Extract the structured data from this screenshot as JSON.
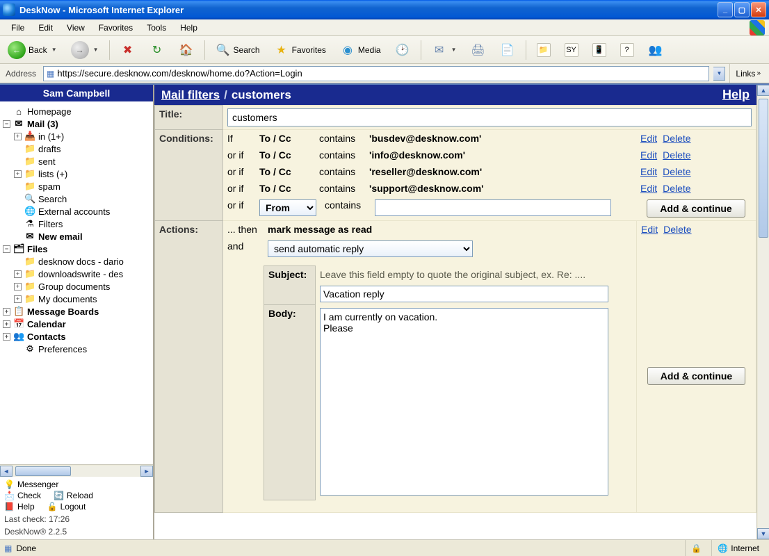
{
  "window": {
    "title": "DeskNow - Microsoft Internet Explorer"
  },
  "menu": {
    "file": "File",
    "edit": "Edit",
    "view": "View",
    "favorites": "Favorites",
    "tools": "Tools",
    "help": "Help"
  },
  "toolbar": {
    "back": "Back",
    "search": "Search",
    "favorites": "Favorites",
    "media": "Media"
  },
  "addressbar": {
    "label": "Address",
    "url": "https://secure.desknow.com/desknow/home.do?Action=Login",
    "links": "Links"
  },
  "sidebar": {
    "user": "Sam Campbell",
    "nodes": {
      "homepage": "Homepage",
      "mail": "Mail (3)",
      "in": "in (1+)",
      "drafts": "drafts",
      "sent": "sent",
      "lists": "lists (+)",
      "spam": "spam",
      "search": "Search",
      "ext": "External accounts",
      "filters": "Filters",
      "newemail": "New email",
      "files": "Files",
      "dnd": "desknow docs - dario",
      "dlw": "downloadswrite - des",
      "grp": "Group documents",
      "mydocs": "My documents",
      "boards": "Message Boards",
      "calendar": "Calendar",
      "contacts": "Contacts",
      "prefs": "Preferences"
    },
    "footer": {
      "messenger": "Messenger",
      "check": "Check",
      "reload": "Reload",
      "help": "Help",
      "logout": "Logout",
      "lastcheck": "Last check: 17:26",
      "version": "DeskNow® 2.2.5"
    }
  },
  "main": {
    "breadcrumb_root": "Mail filters",
    "breadcrumb_sep": "/",
    "breadcrumb_leaf": "customers",
    "help": "Help",
    "labels": {
      "title": "Title:",
      "conditions": "Conditions:",
      "actions": "Actions:",
      "subject": "Subject:",
      "body": "Body:"
    },
    "title_value": "customers",
    "conditions": [
      {
        "prefix": "If",
        "field": "To / Cc",
        "op": "contains",
        "value": "'busdev@desknow.com'",
        "edit": "Edit",
        "del": "Delete"
      },
      {
        "prefix": "or if",
        "field": "To / Cc",
        "op": "contains",
        "value": "'info@desknow.com'",
        "edit": "Edit",
        "del": "Delete"
      },
      {
        "prefix": "or if",
        "field": "To / Cc",
        "op": "contains",
        "value": "'reseller@desknow.com'",
        "edit": "Edit",
        "del": "Delete"
      },
      {
        "prefix": "or if",
        "field": "To / Cc",
        "op": "contains",
        "value": "'support@desknow.com'",
        "edit": "Edit",
        "del": "Delete"
      }
    ],
    "new_condition": {
      "prefix": "or if",
      "field_select": "From",
      "op": "contains",
      "value": "",
      "add": "Add & continue"
    },
    "actions": {
      "then": "... then",
      "first": "mark message as read",
      "edit": "Edit",
      "del": "Delete",
      "and": "and",
      "select": "send automatic reply",
      "subject_hint": "Leave this field empty to quote the original subject, ex. Re: ....",
      "subject_value": "Vacation reply",
      "body_value": "I am currently on vacation.\nPlease ",
      "add": "Add & continue"
    }
  },
  "status": {
    "done": "Done",
    "zone": "Internet"
  }
}
